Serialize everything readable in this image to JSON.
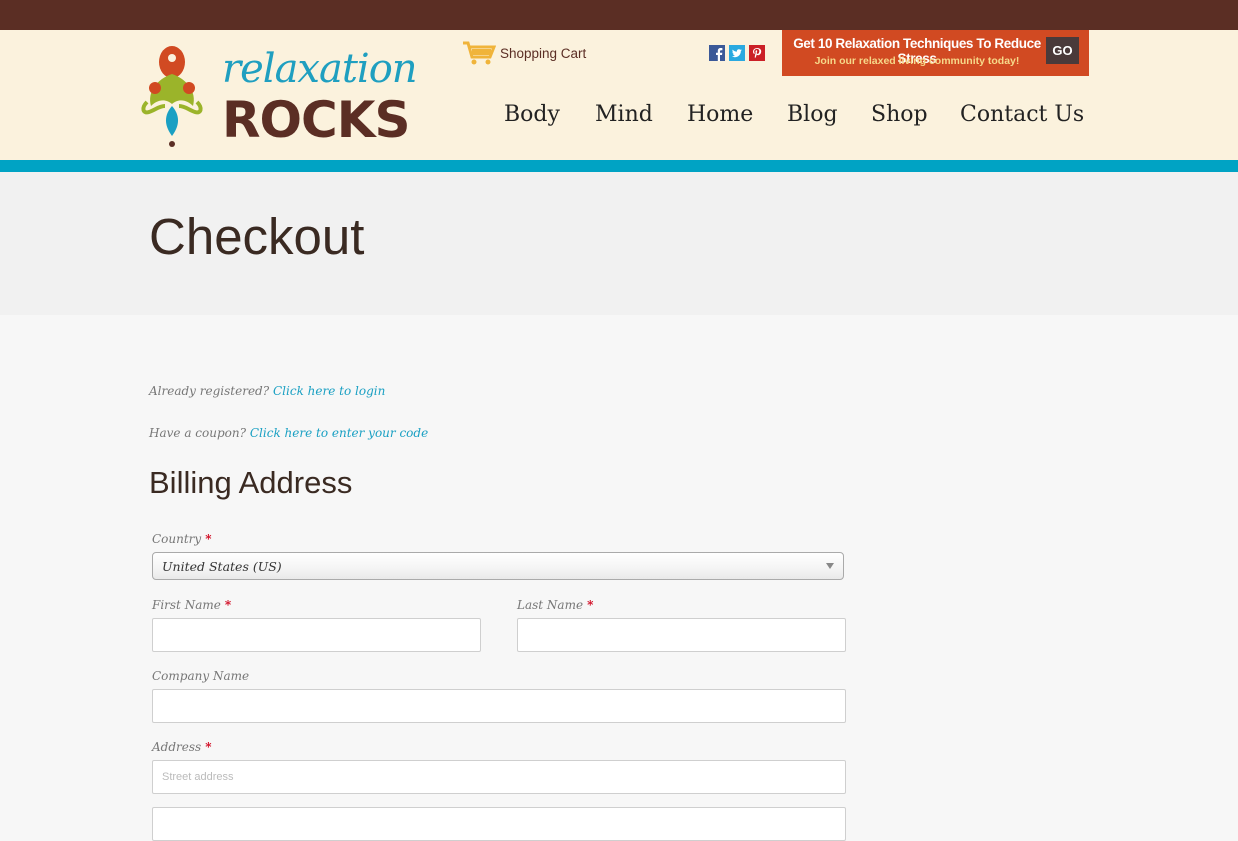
{
  "header": {
    "logo_script": "relaxation",
    "logo_rocks": "ROCKS",
    "cart_label": "Shopping Cart",
    "social": [
      "facebook-icon",
      "twitter-icon",
      "pinterest-icon"
    ],
    "promo": {
      "title": "Get 10 Relaxation Techniques To Reduce Stress",
      "subtitle": "Join our relaxed living community today!",
      "go": "GO"
    },
    "nav": [
      "Body",
      "Mind",
      "Home",
      "Blog",
      "Shop",
      "Contact Us"
    ]
  },
  "page": {
    "title": "Checkout"
  },
  "notices": {
    "login_prefix": "Already registered?",
    "login_link": "Click here to login",
    "coupon_prefix": "Have a coupon?",
    "coupon_link": "Click here to enter your code"
  },
  "billing": {
    "title": "Billing Address",
    "country_label": "Country",
    "country_value": "United States (US)",
    "first_name_label": "First Name",
    "last_name_label": "Last Name",
    "company_label": "Company Name",
    "address_label": "Address",
    "address_placeholder": "Street address",
    "required_mark": "*"
  },
  "colors": {
    "topbar": "#5b2e24",
    "header_bg": "#fbf2dd",
    "accent_stripe": "#00a3c4",
    "promo_bg": "#d14a22",
    "link": "#1aa0c3"
  }
}
